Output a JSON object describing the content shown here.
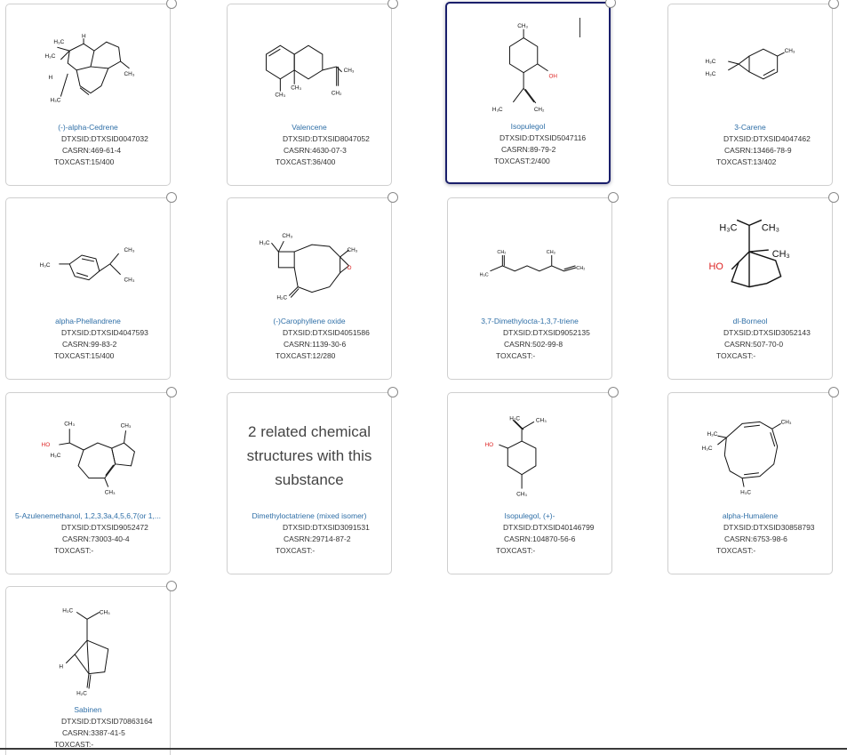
{
  "cards": [
    {
      "name": "(-)-alpha-Cedrene",
      "dtxsid": "DTXSID:DTXSID0047032",
      "casrn": "CASRN:469-61-4",
      "toxcast": "TOXCAST:15/400"
    },
    {
      "name": "Valencene",
      "dtxsid": "DTXSID:DTXSID8047052",
      "casrn": "CASRN:4630-07-3",
      "toxcast": "TOXCAST:36/400"
    },
    {
      "name": "Isopulegol",
      "dtxsid": "DTXSID:DTXSID5047116",
      "casrn": "CASRN:89-79-2",
      "toxcast": "TOXCAST:2/400",
      "selected": true
    },
    {
      "name": "3-Carene",
      "dtxsid": "DTXSID:DTXSID4047462",
      "casrn": "CASRN:13466-78-9",
      "toxcast": "TOXCAST:13/402"
    },
    {
      "name": "alpha-Phellandrene",
      "dtxsid": "DTXSID:DTXSID4047593",
      "casrn": "CASRN:99-83-2",
      "toxcast": "TOXCAST:15/400"
    },
    {
      "name": "(-)Carophyllene oxide",
      "dtxsid": "DTXSID:DTXSID4051586",
      "casrn": "CASRN:1139-30-6",
      "toxcast": "TOXCAST:12/280"
    },
    {
      "name": "3,7-Dimethylocta-1,3,7-triene",
      "dtxsid": "DTXSID:DTXSID9052135",
      "casrn": "CASRN:502-99-8",
      "toxcast": "TOXCAST:-"
    },
    {
      "name": "dl-Borneol",
      "dtxsid": "DTXSID:DTXSID3052143",
      "casrn": "CASRN:507-70-0",
      "toxcast": "TOXCAST:-"
    },
    {
      "name": "5-Azulenemethanol, 1,2,3,3a,4,5,6,7(or 1,...",
      "dtxsid": "DTXSID:DTXSID9052472",
      "casrn": "CASRN:73003-40-4",
      "toxcast": "TOXCAST:-"
    },
    {
      "name": "Dimethyloctatriene (mixed isomer)",
      "dtxsid": "DTXSID:DTXSID3091531",
      "casrn": "CASRN:29714-87-2",
      "toxcast": "TOXCAST:-",
      "related": "2 related chemical structures with this substance"
    },
    {
      "name": "Isopulegol, (+)-",
      "dtxsid": "DTXSID:DTXSID40146799",
      "casrn": "CASRN:104870-56-6",
      "toxcast": "TOXCAST:-"
    },
    {
      "name": "alpha-Humalene",
      "dtxsid": "DTXSID:DTXSID30858793",
      "casrn": "CASRN:6753-98-6",
      "toxcast": "TOXCAST:-"
    },
    {
      "name": "Sabinen",
      "dtxsid": "DTXSID:DTXSID70863164",
      "casrn": "CASRN:3387-41-5",
      "toxcast": "TOXCAST:-"
    }
  ],
  "labels": {
    "ch3": "CH₃",
    "h3c": "H₃C",
    "ch2": "CH₂",
    "h2c": "H₂C",
    "oh": "OH",
    "ho": "HO",
    "h": "H",
    "o": "O"
  }
}
